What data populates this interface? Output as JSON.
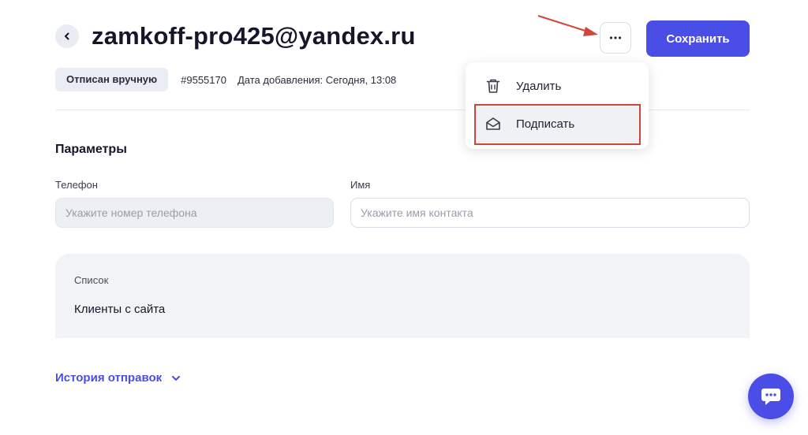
{
  "header": {
    "title": "zamkoff-pro425@yandex.ru",
    "save_label": "Сохранить"
  },
  "meta": {
    "status_badge": "Отписан вручную",
    "contact_id": "#9555170",
    "added_date": "Дата добавления: Сегодня, 13:08"
  },
  "menu": {
    "items": [
      {
        "label": "Удалить",
        "icon": "trash-icon"
      },
      {
        "label": "Подписать",
        "icon": "envelope-open-icon"
      }
    ],
    "highlighted_item": "Подписать"
  },
  "params": {
    "title": "Параметры",
    "phone": {
      "label": "Телефон",
      "placeholder": "Укажите номер телефона",
      "value": ""
    },
    "name": {
      "label": "Имя",
      "placeholder": "Укажите имя контакта",
      "value": ""
    }
  },
  "list": {
    "label": "Список",
    "value": "Клиенты с сайта"
  },
  "history": {
    "label": "История отправок"
  },
  "colors": {
    "accent": "#4a4de6",
    "highlight_border": "#c9483a",
    "annotation_arrow": "#d0463a"
  },
  "icons": [
    "back-chevron-icon",
    "more-dots-icon",
    "trash-icon",
    "envelope-open-icon",
    "chevron-down-icon",
    "chat-icon"
  ]
}
